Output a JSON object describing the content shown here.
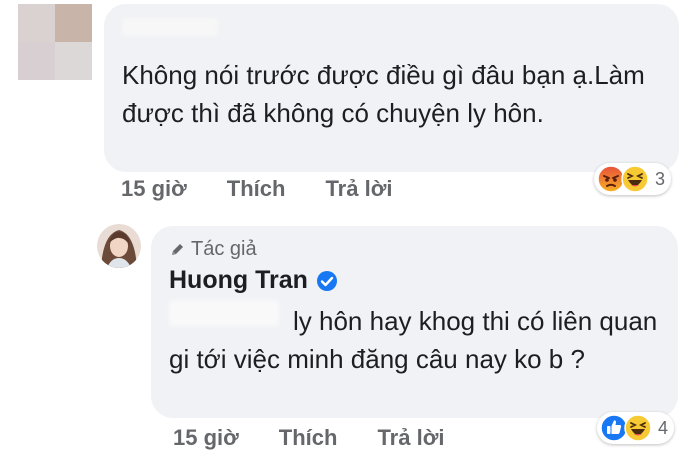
{
  "comment": {
    "text": "Không nói trước được điều gì đâu bạn ạ.Làm được thì đã không có chuyện ly hôn.",
    "time": "15 giờ",
    "like_label": "Thích",
    "reply_label": "Trả lời",
    "reaction_count": "3",
    "reactions": [
      "angry-icon",
      "haha-icon"
    ]
  },
  "reply": {
    "author_tag": "Tác giả",
    "author_name": "Huong Tran",
    "text": "ly hôn hay khog thi có liên quan gi tới việc minh đăng câu nay ko b ?",
    "time": "15 giờ",
    "like_label": "Thích",
    "reply_label": "Trả lời",
    "reaction_count": "4",
    "reactions": [
      "like-icon",
      "haha-icon"
    ]
  },
  "colors": {
    "bubble": "#f0f2f5",
    "meta_text": "#65676b",
    "verified": "#1877f2"
  }
}
